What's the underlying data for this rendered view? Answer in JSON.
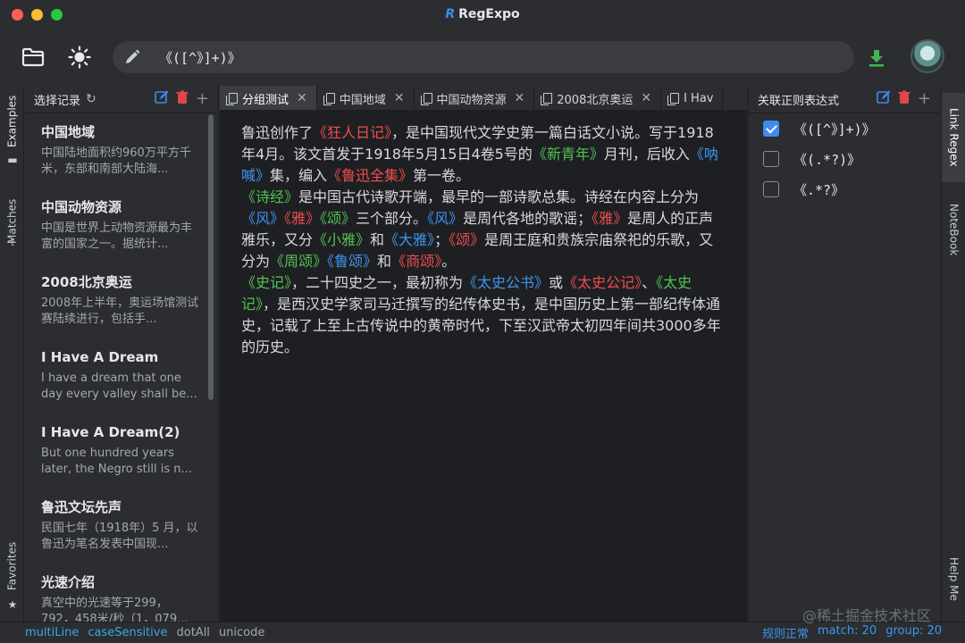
{
  "app": {
    "title": "RegExpo",
    "logo": "R"
  },
  "toolbar": {
    "regex_value": "《([^》]+)》"
  },
  "sidebar_left": {
    "examples": "Examples",
    "matches": "Matches",
    "favorites": "Favorites"
  },
  "records": {
    "header": "选择记录",
    "items": [
      {
        "title": "中国地域",
        "snippet": "中国陆地面积约960万平方千米，东部和南部大陆海..."
      },
      {
        "title": "中国动物资源",
        "snippet": "中国是世界上动物资源最为丰富的国家之一。据统计..."
      },
      {
        "title": "2008北京奥运",
        "snippet": "2008年上半年，奥运场馆测试赛陆续进行，包括手..."
      },
      {
        "title": "I Have A Dream",
        "snippet": "I have a dream that one day every valley shall be..."
      },
      {
        "title": "I Have A Dream(2)",
        "snippet": "But one hundred years later, the Negro still is n..."
      },
      {
        "title": "鲁迅文坛先声",
        "snippet": "民国七年（1918年）5 月，以鲁迅为笔名发表中国现..."
      },
      {
        "title": "光速介绍",
        "snippet": "真空中的光速等于299，792，458米/秒（1，079..."
      }
    ]
  },
  "tabs": [
    {
      "label": "分组测试",
      "active": true
    },
    {
      "label": "中国地域",
      "active": false
    },
    {
      "label": "中国动物资源",
      "active": false
    },
    {
      "label": "2008北京奥运",
      "active": false
    },
    {
      "label": "I Hav",
      "active": false
    }
  ],
  "editor": {
    "segments": [
      {
        "t": "鲁迅创作了"
      },
      {
        "t": "《狂人日记》",
        "c": "red"
      },
      {
        "t": "，是中国现代文学史第一篇白话文小说。写于1918年4月。该文首发于1918年5月15日4卷5号的"
      },
      {
        "t": "《新青年》",
        "c": "green"
      },
      {
        "t": "月刊，后收入"
      },
      {
        "t": "《呐喊》",
        "c": "blue"
      },
      {
        "t": "集，编入"
      },
      {
        "t": "《鲁迅全集》",
        "c": "red"
      },
      {
        "t": "第一卷。"
      },
      {
        "br": true
      },
      {
        "t": "《诗经》",
        "c": "green"
      },
      {
        "t": "是中国古代诗歌开端，最早的一部诗歌总集。诗经在内容上分为"
      },
      {
        "t": "《风》",
        "c": "blue"
      },
      {
        "t": "《雅》",
        "c": "red"
      },
      {
        "t": "《颂》",
        "c": "green"
      },
      {
        "t": "三个部分。"
      },
      {
        "t": "《风》",
        "c": "blue"
      },
      {
        "t": "是周代各地的歌谣；"
      },
      {
        "t": "《雅》",
        "c": "red"
      },
      {
        "t": "是周人的正声雅乐，又分"
      },
      {
        "t": "《小雅》",
        "c": "green"
      },
      {
        "t": "和"
      },
      {
        "t": "《大雅》",
        "c": "blue"
      },
      {
        "t": "；"
      },
      {
        "t": "《颂》",
        "c": "red"
      },
      {
        "t": "是周王庭和贵族宗庙祭祀的乐歌，又分为"
      },
      {
        "t": "《周颂》",
        "c": "green"
      },
      {
        "t": "《鲁颂》",
        "c": "blue"
      },
      {
        "t": "和"
      },
      {
        "t": "《商颂》",
        "c": "red"
      },
      {
        "t": "。"
      },
      {
        "br": true
      },
      {
        "t": "《史记》",
        "c": "green"
      },
      {
        "t": "，二十四史之一，最初称为"
      },
      {
        "t": "《太史公书》",
        "c": "blue"
      },
      {
        "t": "或"
      },
      {
        "t": "《太史公记》",
        "c": "red"
      },
      {
        "t": "、"
      },
      {
        "t": "《太史记》",
        "c": "green"
      },
      {
        "t": "，是西汉史学家司马迁撰写的纪传体史书，是中国历史上第一部纪传体通史，记载了上至上古传说中的黄帝时代，下至汉武帝太初四年间共3000多年的历史。"
      }
    ]
  },
  "linked_regex": {
    "header": "关联正则表达式",
    "items": [
      {
        "pattern": "《([^》]+)》",
        "checked": true
      },
      {
        "pattern": "《(.*?)》",
        "checked": false
      },
      {
        "pattern": "《.*?》",
        "checked": false
      }
    ]
  },
  "sidebar_right": {
    "link_regex": "Link Regex",
    "notebook": "NoteBook",
    "help": "Help Me"
  },
  "status": {
    "flags": [
      {
        "label": "multiLine",
        "on": true
      },
      {
        "label": "caseSensitive",
        "on": true
      },
      {
        "label": "dotAll",
        "on": false
      },
      {
        "label": "unicode",
        "on": false
      }
    ],
    "regex_state": "规则正常",
    "match": "match: 20",
    "group": "group: 20"
  },
  "watermark": "@稀土掘金技术社区",
  "colors": {
    "red": "#ef4d4d",
    "green": "#52c252",
    "blue": "#3d95f0",
    "accent": "#3d8cf0"
  }
}
